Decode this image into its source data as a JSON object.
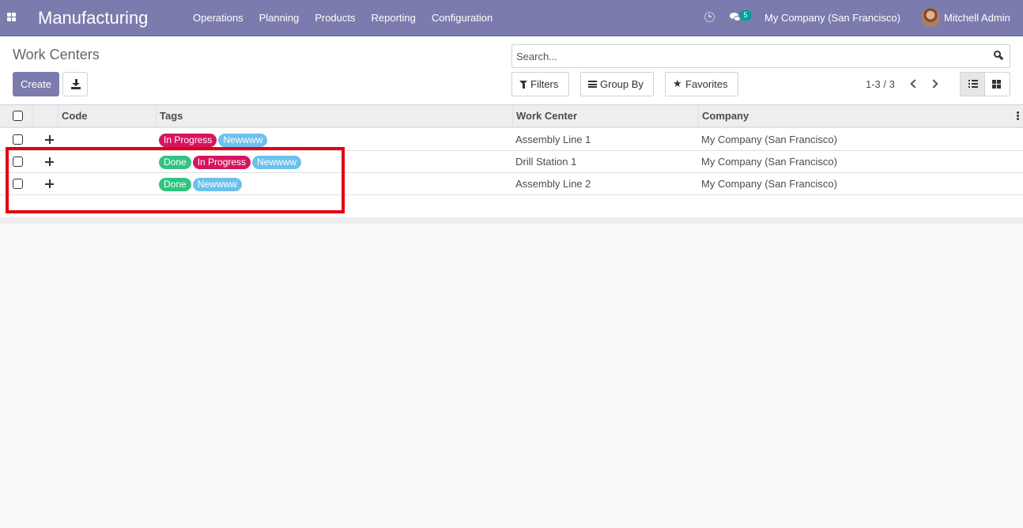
{
  "navbar": {
    "app_name": "Manufacturing",
    "menu": [
      "Operations",
      "Planning",
      "Products",
      "Reporting",
      "Configuration"
    ],
    "chat_count": "5",
    "company": "My Company (San Francisco)",
    "user": "Mitchell Admin",
    "background_color": "#7c7bad"
  },
  "control_panel": {
    "title": "Work Centers",
    "create_label": "Create",
    "search_placeholder": "Search...",
    "filters_label": "Filters",
    "group_by_label": "Group By",
    "favorites_label": "Favorites",
    "pager": "1-3 / 3",
    "active_view": "list"
  },
  "table": {
    "columns": [
      "Code",
      "Tags",
      "Work Center",
      "Company"
    ],
    "rows": [
      {
        "code": "",
        "tags": [
          {
            "label": "In Progress",
            "color": "#d6145f"
          },
          {
            "label": "Newwww",
            "color": "#6cc1ed"
          }
        ],
        "work_center": "Assembly Line 1",
        "company": "My Company (San Francisco)"
      },
      {
        "code": "",
        "tags": [
          {
            "label": "Done",
            "color": "#30c381"
          },
          {
            "label": "In Progress",
            "color": "#d6145f"
          },
          {
            "label": "Newwww",
            "color": "#6cc1ed"
          }
        ],
        "work_center": "Drill Station 1",
        "company": "My Company (San Francisco)"
      },
      {
        "code": "",
        "tags": [
          {
            "label": "Done",
            "color": "#30c381"
          },
          {
            "label": "Newwww",
            "color": "#6cc1ed"
          }
        ],
        "work_center": "Assembly Line 2",
        "company": "My Company (San Francisco)"
      }
    ]
  },
  "annotation": {
    "highlight_color": "#e3000f"
  }
}
